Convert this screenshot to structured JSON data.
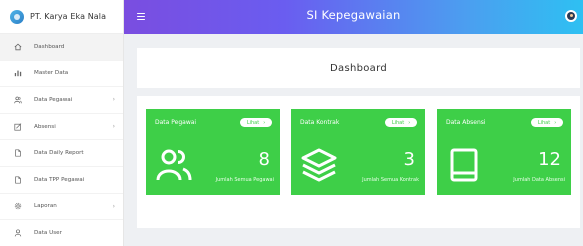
{
  "brand": {
    "name": "PT. Karya Eka Nala"
  },
  "topbar": {
    "title": "SI Kepegawaian"
  },
  "sidebar": {
    "items": [
      {
        "label": "Dashboard",
        "icon": "home-icon",
        "active": true,
        "has_caret": false
      },
      {
        "label": "Master Data",
        "icon": "bar-chart-icon",
        "active": false,
        "has_caret": false
      },
      {
        "label": "Data Pegawai",
        "icon": "users-icon",
        "active": false,
        "has_caret": true
      },
      {
        "label": "Absensi",
        "icon": "edit-icon",
        "active": false,
        "has_caret": true
      },
      {
        "label": "Data Daily Report",
        "icon": "document-icon",
        "active": false,
        "has_caret": false
      },
      {
        "label": "Data TPP Pegawai",
        "icon": "document-icon",
        "active": false,
        "has_caret": false
      },
      {
        "label": "Laporan",
        "icon": "settings-icon",
        "active": false,
        "has_caret": true
      },
      {
        "label": "Data User",
        "icon": "user-icon",
        "active": false,
        "has_caret": false
      }
    ]
  },
  "main": {
    "page_title": "Dashboard"
  },
  "cards": [
    {
      "title": "Data Pegawai",
      "button": "Lihat",
      "value": "8",
      "caption": "Jumlah Semua Pegawai",
      "icon": "users-icon"
    },
    {
      "title": "Data Kontrak",
      "button": "Lihat",
      "value": "3",
      "caption": "Jumlah Semua Kontrak",
      "icon": "layers-icon"
    },
    {
      "title": "Data Absensi",
      "button": "Lihat",
      "value": "12",
      "caption": "Jumlah Data Absensi",
      "icon": "book-icon"
    }
  ],
  "colors": {
    "card": "#3ecf48",
    "topbar_start": "#7a4de0",
    "topbar_end": "#2ec0f2"
  }
}
